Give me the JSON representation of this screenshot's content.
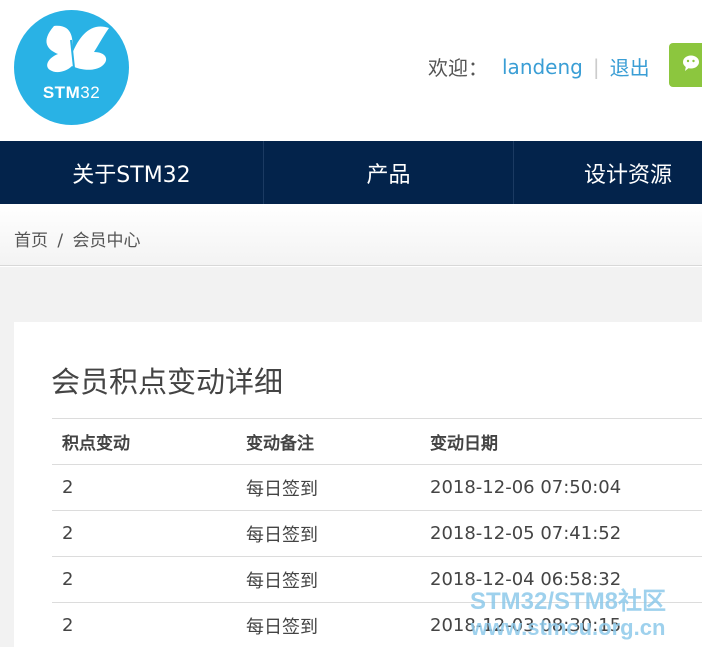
{
  "header": {
    "logo_text_bold": "STM",
    "logo_text_thin": "32",
    "welcome_label": "欢迎：",
    "username": "landeng",
    "separator": "|",
    "logout_label": "退出"
  },
  "nav": {
    "items": [
      "关于STM32",
      "产品",
      "设计资源"
    ]
  },
  "breadcrumb": {
    "home": "首页",
    "separator": "/",
    "current": "会员中心"
  },
  "panel": {
    "title": "会员积点变动详细",
    "columns": [
      "积点变动",
      "变动备注",
      "变动日期"
    ],
    "rows": [
      {
        "change": "2",
        "note": "每日签到",
        "date": "2018-12-06 07:50:04"
      },
      {
        "change": "2",
        "note": "每日签到",
        "date": "2018-12-05 07:41:52"
      },
      {
        "change": "2",
        "note": "每日签到",
        "date": "2018-12-04 06:58:32"
      },
      {
        "change": "2",
        "note": "每日签到",
        "date": "2018-12-03 08:30:15"
      }
    ]
  },
  "watermark": {
    "line1": "STM32/STM8社区",
    "line2": "www.stmcu.org.cn"
  },
  "colors": {
    "brand_blue": "#29b2e5",
    "nav_bg": "#03234b",
    "link_blue": "#3a9ed5",
    "wechat_green": "#8cc63e"
  }
}
